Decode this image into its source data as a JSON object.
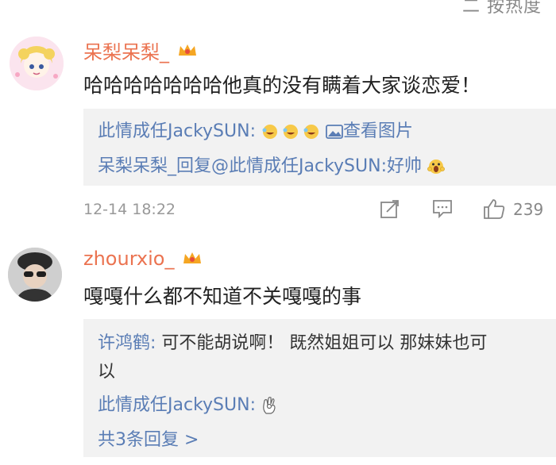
{
  "header": {
    "sort_label": "二 按热度"
  },
  "comments": [
    {
      "username": "呆梨呆梨_",
      "text": "哈哈哈哈哈哈哈他真的没有瞒着大家谈恋爱！",
      "replies": [
        {
          "author": "此情成任JackySUN:",
          "image_link": "查看图片"
        },
        {
          "author": "呆梨呆梨_",
          "text": "回复@此情成任JackySUN:好帅"
        }
      ],
      "timestamp": "12-14 18:22",
      "like_count": "239"
    },
    {
      "username": "zhourxio_",
      "text": "嘎嘎什么都不知道不关嘎嘎的事",
      "replies": [
        {
          "author": "许鸿鹤:",
          "text": "可不能胡说啊！ 既然姐姐可以 那妹妹也可",
          "text_cont": "以"
        },
        {
          "author": "此情成任JackySUN:"
        }
      ],
      "more_replies": "共3条回复 >"
    }
  ],
  "colors": {
    "username": "#eb7350",
    "link": "#5a7db5",
    "reply_bg": "#f2f2f2",
    "meta": "#999999"
  }
}
